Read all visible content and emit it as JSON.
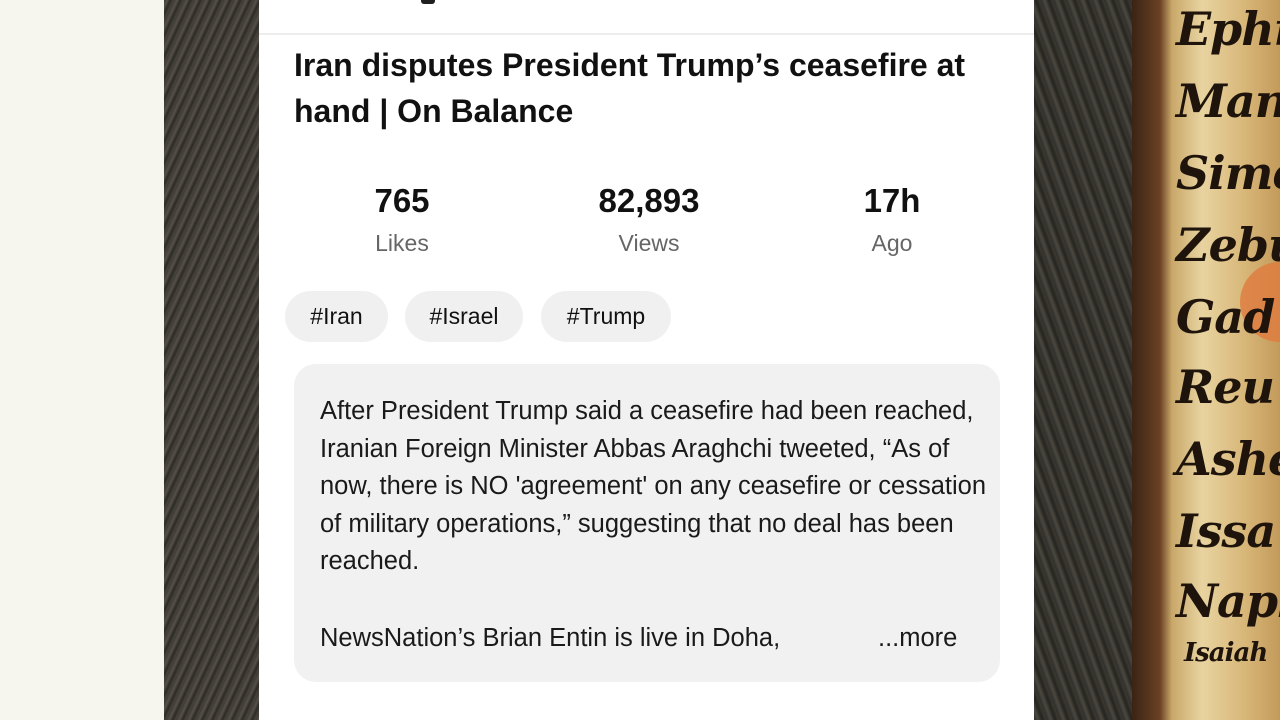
{
  "video": {
    "title": "Iran disputes President Trump’s ceasefire at hand | On Balance",
    "stats": [
      {
        "value": "765",
        "label": "Likes"
      },
      {
        "value": "82,893",
        "label": "Views"
      },
      {
        "value": "17h",
        "label": "Ago"
      }
    ],
    "tags": [
      "#Iran",
      "#Israel",
      "#Trump"
    ],
    "description": "After President Trump said a ceasefire had been reached, Iranian Foreign Minister Abbas Araghchi tweeted, “As of now, there is NO 'agreement' on any ceasefire or cessation of military operations,” suggesting that no deal has been reached.",
    "description_continued": "NewsNation’s Brian Entin is live in Doha,",
    "more_label": "...more"
  },
  "background": {
    "scroll_names": [
      "Ephr",
      "Mana",
      "Sime",
      "Zebu",
      "Gad",
      "Reu",
      "Ashe",
      "Issa",
      "Naph",
      "Isaiah"
    ]
  }
}
